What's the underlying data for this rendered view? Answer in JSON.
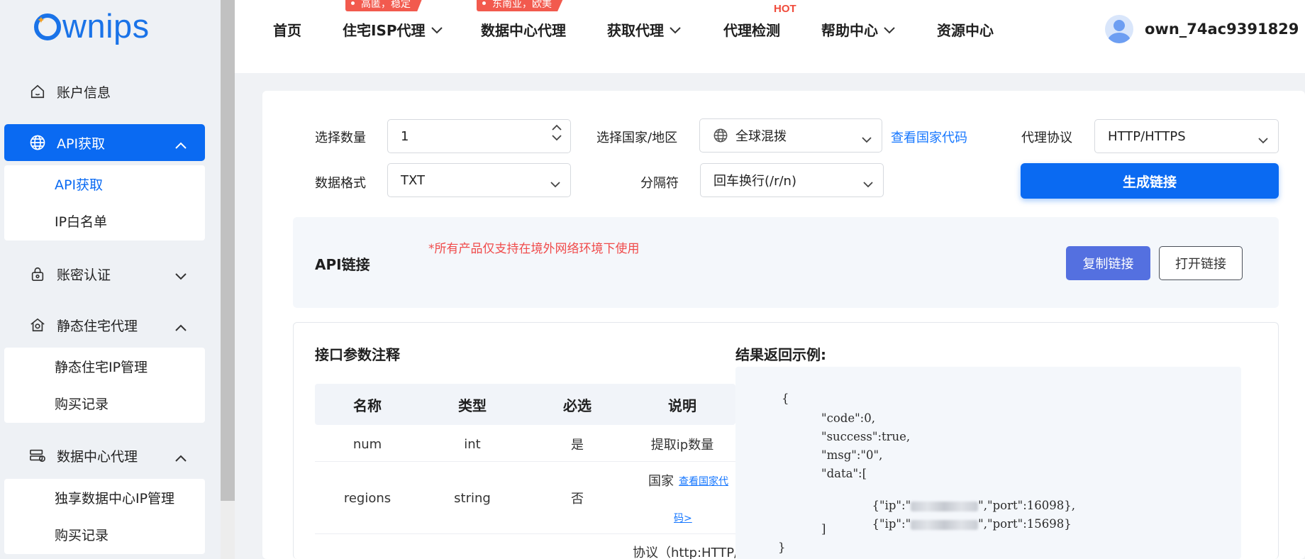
{
  "logo": {
    "text": "wnips"
  },
  "sidebar": {
    "account": "账户信息",
    "api": "API获取",
    "api_sub": [
      "API获取",
      "IP白名单"
    ],
    "auth": "账密认证",
    "static": "静态住宅代理",
    "static_sub": [
      "静态住宅IP管理",
      "购买记录"
    ],
    "datacenter": "数据中心代理",
    "datacenter_sub": [
      "独享数据中心IP管理",
      "购买记录"
    ]
  },
  "topnav": {
    "home": "首页",
    "isp": "住宅ISP代理",
    "isp_tag": "高匿，稳定",
    "dc": "数据中心代理",
    "dc_tag": "东南亚，欧美",
    "get_proxy": "获取代理",
    "check": "代理检测",
    "hot": "HOT",
    "help": "帮助中心",
    "resources": "资源中心",
    "username": "own_74ac9391829"
  },
  "form": {
    "qty_label": "选择数量",
    "qty_value": "1",
    "country_label": "选择国家/地区",
    "country_value": "全球混拨",
    "country_link": "查看国家代码",
    "protocol_label": "代理协议",
    "protocol_value": "HTTP/HTTPS",
    "format_label": "数据格式",
    "format_value": "TXT",
    "sep_label": "分隔符",
    "sep_value": "回车换行(/r/n)",
    "generate": "生成链接"
  },
  "api_link": {
    "title": "API链接",
    "note": "*所有产品仅支持在境外网络环境下使用",
    "copy": "复制链接",
    "open": "打开链接"
  },
  "params": {
    "title": "接口参数注释",
    "headers": [
      "名称",
      "类型",
      "必选",
      "说明"
    ],
    "rows": [
      {
        "name": "num",
        "type": "int",
        "required": "是",
        "desc": "提取ip数量"
      },
      {
        "name": "regions",
        "type": "string",
        "required": "否",
        "desc": "国家",
        "link1": "查看国家代",
        "link2": "码>"
      }
    ],
    "partial_row": "协议（http:HTTP/"
  },
  "result": {
    "title": "结果返回示例:",
    "lines": [
      "{",
      "\"code\":0,",
      "\"success\":true,",
      "\"msg\":\"0\",",
      "\"data\":[",
      "{\"ip\":\"",
      "\",\"port\":16098},",
      "{\"ip\":\"",
      "\",\"port\":15698}",
      "]",
      "}"
    ]
  }
}
